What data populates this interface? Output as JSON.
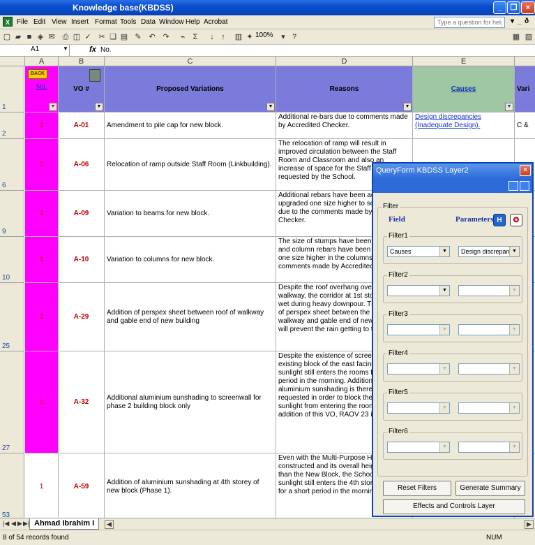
{
  "window": {
    "title": "Knowledge base(KBDSS)"
  },
  "menu": {
    "items": [
      "File",
      "Edit",
      "View",
      "Insert",
      "Format",
      "Tools",
      "Data",
      "Window",
      "Help",
      "Acrobat"
    ],
    "ask_placeholder": "Type a question for help"
  },
  "toolbar": {
    "zoom": "100%"
  },
  "formula": {
    "name_box": "A1",
    "fx": "fx",
    "value": "No."
  },
  "columns": [
    "A",
    "B",
    "C",
    "D",
    "E"
  ],
  "columns_extra": "Vari",
  "header": {
    "back": "BACK",
    "no": "No.",
    "vo": "VO #",
    "proposed": "Proposed Variations",
    "reasons": "Reasons",
    "causes": "Causes",
    "vari": "Vari"
  },
  "rows": [
    {
      "num": "2",
      "no": "1",
      "vo": "A-01",
      "proposed": "Amendment to pile cap for new block.",
      "reasons": "Additional re-bars due to comments made by Accredited Checker.",
      "causes": "Design discrepancies (Inadequate Design).",
      "extra": "C &"
    },
    {
      "num": "6",
      "no": "1",
      "vo": "A-06",
      "proposed": "Relocation of ramp outside Staff Room (Linkbuilding).",
      "reasons": "The relocation of ramp will result in improved circulation between the Staff Room and Classroom and also an increase of space for the Staff Room as requested by the School.",
      "causes": "",
      "extra": ""
    },
    {
      "num": "9",
      "no": "1",
      "vo": "A-09",
      "proposed": "Variation to beams for new block.",
      "reasons": "Additional rebars have been added and upgraded one size higher to some beams due to the comments made by Accredited Checker.",
      "causes": "",
      "extra": ""
    },
    {
      "num": "10",
      "no": "1",
      "vo": "A-10",
      "proposed": "Variation to columns for new block.",
      "reasons": "The size of stumps have been increased and column rebars have been upgraded one size higher in the columns due to the comments made by Accredited Checker.",
      "causes": "",
      "extra": ""
    },
    {
      "num": "25",
      "no": "1",
      "vo": "A-29",
      "proposed": "Addition of perspex sheet between roof of walkway and gable end of new building",
      "reasons": "Despite the roof overhang over the walkway, the corridor at 1st storey gets wet during heavy downpour. The addition of perspex sheet between the roof of walkway and gable end of new building will prevent the rain getting to the corridor.",
      "causes": "",
      "extra": ""
    },
    {
      "num": "27",
      "no": "1",
      "vo": "A-32",
      "proposed": "Additional aluminium sunshading to screenwall for phase 2 building block only",
      "reasons": "Despite the existence of screenwall at the existing block of the east facing wall, the sunlight still enters the rooms for a short period in the morning. Additional aluminium sunshading is therefore requested in order to block the direct sunlight from entering the rooms. With the addition of this VO, RAOV 23 is cancelled.",
      "causes": "",
      "extra": ""
    },
    {
      "num": "53",
      "no": "1",
      "vo": "A-59",
      "proposed": "Addition of aluminium sunshading at 4th storey of new block (Phase 1).",
      "reasons": "Even with the Multi-Purpose Hall constructed and its overall height is higher than the New Block, the School finds that sunlight still enters the 4th storey rooms for a short period in the morning.",
      "causes": "",
      "extra": ""
    }
  ],
  "sheet_tab": "Ahmad Ibrahim I",
  "status": {
    "text": "8 of 54 records found",
    "num": "NUM"
  },
  "dialog": {
    "title": "QueryForm KBDSS Layer2",
    "filter_group": "Filter",
    "field_label": "Field",
    "parameters_label": "Parameters",
    "filters": [
      {
        "label": "Filter1",
        "field": "Causes",
        "param": "Design discrepanci"
      },
      {
        "label": "Filter2",
        "field": "",
        "param": ""
      },
      {
        "label": "Filter3",
        "field": "",
        "param": ""
      },
      {
        "label": "Filter4",
        "field": "",
        "param": ""
      },
      {
        "label": "Filter5",
        "field": "",
        "param": ""
      },
      {
        "label": "Filter6",
        "field": "",
        "param": ""
      }
    ],
    "reset_button": "Reset Filters",
    "generate_button": "Generate Summary",
    "effects_button": "Effects and Controls Layer"
  }
}
